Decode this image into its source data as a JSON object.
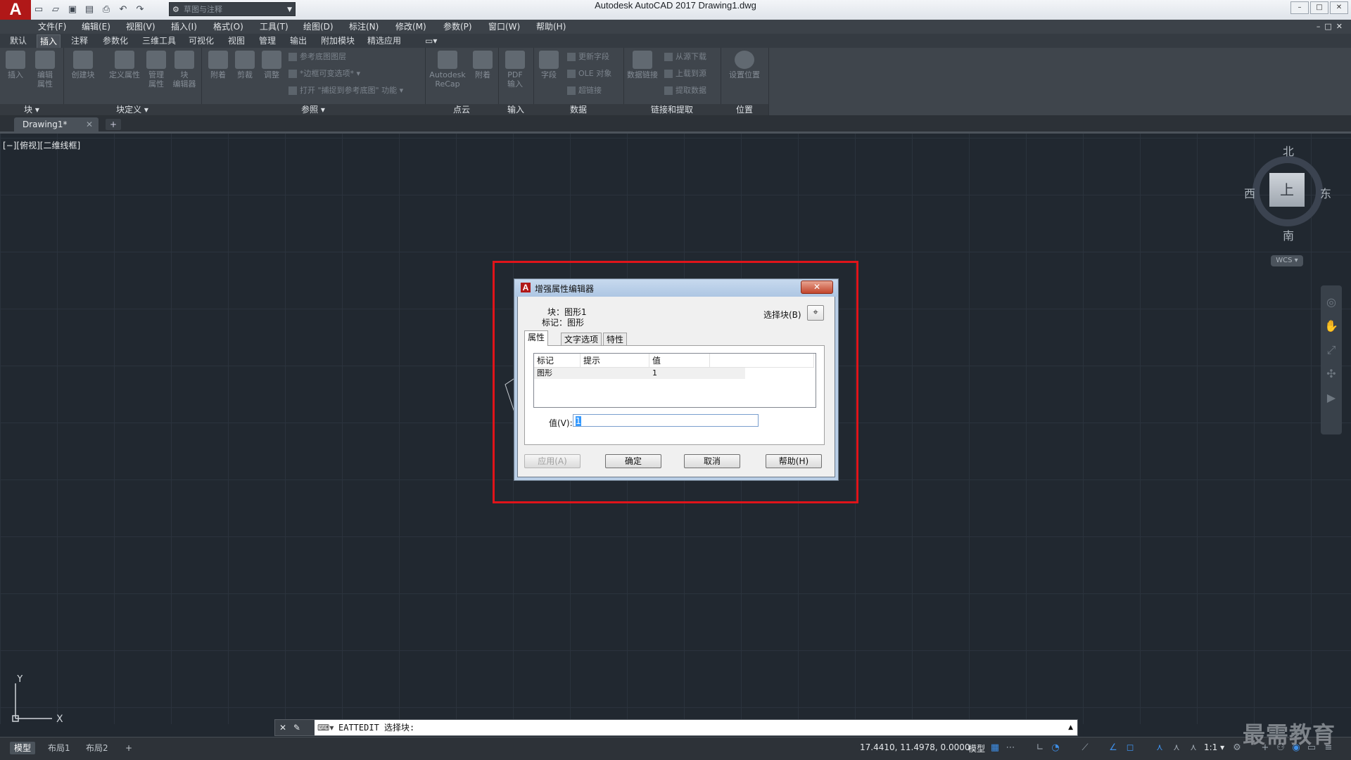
{
  "app": {
    "logo": "A",
    "title": "Autodesk AutoCAD 2017    Drawing1.dwg"
  },
  "quick_access": {
    "workspace": "草图与注释",
    "icons": [
      "new-icon",
      "open-icon",
      "save-icon",
      "save-as-icon",
      "print-icon",
      "undo-icon",
      "redo-icon"
    ]
  },
  "window_controls": [
    "–",
    "□",
    "✕"
  ],
  "menus": [
    "文件(F)",
    "编辑(E)",
    "视图(V)",
    "插入(I)",
    "格式(O)",
    "工具(T)",
    "绘图(D)",
    "标注(N)",
    "修改(M)",
    "参数(P)",
    "窗口(W)",
    "帮助(H)"
  ],
  "ribbon_tabs": [
    "默认",
    "插入",
    "注释",
    "参数化",
    "三维工具",
    "可视化",
    "视图",
    "管理",
    "输出",
    "附加模块",
    "精选应用"
  ],
  "active_ribbon_tab": "插入",
  "ribbon": {
    "block": {
      "title": "块 ▾",
      "buttons": [
        "插入",
        "编辑\n属性"
      ]
    },
    "block_def": {
      "title": "块定义 ▾",
      "buttons": [
        "创建块",
        "定义属性",
        "管理\n属性",
        "块\n编辑器"
      ]
    },
    "reference": {
      "title": "参照 ▾",
      "buttons": [
        "附着",
        "剪裁",
        "调整"
      ],
      "small": [
        "参考底图图层",
        "*边框可变选项*",
        "打开 \"捕捉到参考底图\" 功能"
      ]
    },
    "pointcloud": {
      "title": "点云",
      "buttons": [
        "Autodesk\nReCap",
        "附着"
      ]
    },
    "import": {
      "title": "输入",
      "buttons": [
        "PDF\n输入"
      ]
    },
    "data": {
      "title": "数据",
      "buttons": [
        "字段"
      ],
      "small": [
        "更新字段",
        "OLE 对象",
        "超链接"
      ]
    },
    "linking": {
      "title": "链接和提取",
      "buttons": [
        "数据链接"
      ],
      "small": [
        "从源下载",
        "上载到源",
        "提取数据"
      ]
    },
    "location": {
      "title": "位置",
      "buttons": [
        "设置位置"
      ]
    }
  },
  "doc_tab": {
    "name": "Drawing1*",
    "close": "✕",
    "new": "+"
  },
  "viewport_label": "[−][俯视][二维线框]",
  "viewcube": {
    "north": "北",
    "south": "南",
    "east": "东",
    "west": "西",
    "face": "上",
    "wcs": "WCS ▾"
  },
  "ucs": {
    "x": "X",
    "y": "Y"
  },
  "dialog": {
    "title": "增强属性编辑器",
    "close": "✕",
    "block_label": "块：图形1",
    "tag_label": "标记：图形",
    "select_block": "选择块(B)",
    "select_icon": "⌖",
    "tabs": [
      "属性",
      "文字选项",
      "特性"
    ],
    "active_tab": "属性",
    "table": {
      "headers": [
        "标记",
        "提示",
        "值"
      ],
      "rows": [
        {
          "tag": "图形",
          "prompt": "",
          "value": "1"
        }
      ]
    },
    "value_label": "值(V):",
    "value": "1",
    "buttons": {
      "apply": "应用(A)",
      "ok": "确定",
      "cancel": "取消",
      "help": "帮助(H)"
    }
  },
  "command_line": {
    "text": "EATTEDIT 选择块:",
    "close": "✕",
    "settings": "🔧"
  },
  "layout_tabs": [
    "模型",
    "布局1",
    "布局2",
    "+"
  ],
  "status": {
    "coords": "17.4410, 11.4978, 0.0000",
    "mode": "模型",
    "scale": "1:1 ▾"
  },
  "watermark": "最需教育"
}
